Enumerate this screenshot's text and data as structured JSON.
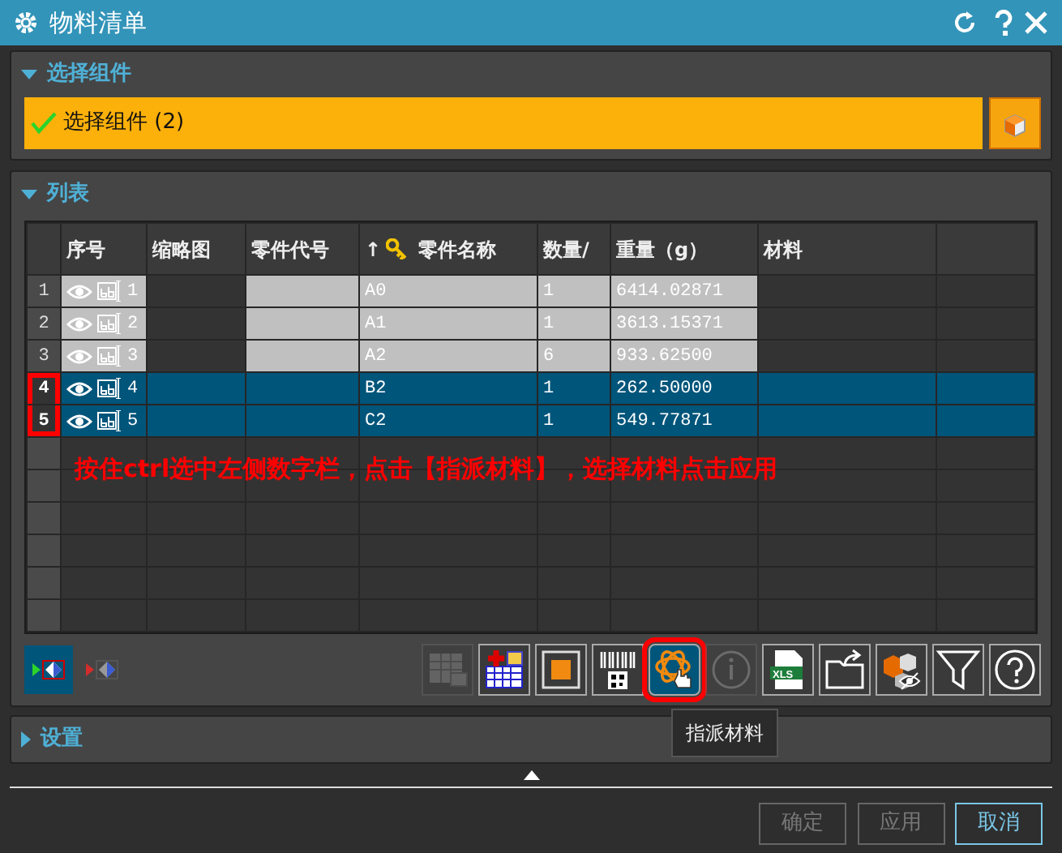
{
  "window": {
    "title": "物料清单"
  },
  "select_section": {
    "title": "选择组件",
    "expanded": true,
    "field": {
      "label": "选择组件 (2)",
      "valid": true
    }
  },
  "list_section": {
    "title": "列表",
    "expanded": true,
    "table": {
      "columns": [
        {
          "label": "序号",
          "sorted": false
        },
        {
          "label": "缩略图",
          "sorted": false
        },
        {
          "label": "零件代号",
          "sorted": false
        },
        {
          "label": "零件名称",
          "sorted": true,
          "sort_mark": "↑"
        },
        {
          "label": "数量/",
          "sorted": false
        },
        {
          "label": "重量（g）",
          "sorted": false
        },
        {
          "label": "材料",
          "sorted": false
        }
      ],
      "rows": [
        {
          "index": "1",
          "seq": "1",
          "part_code": "",
          "part_name": "A0",
          "quantity": "1",
          "weight": "6414.02871",
          "material": "",
          "selected": false,
          "circled": false
        },
        {
          "index": "2",
          "seq": "2",
          "part_code": "",
          "part_name": "A1",
          "quantity": "1",
          "weight": "3613.15371",
          "material": "",
          "selected": false,
          "circled": false
        },
        {
          "index": "3",
          "seq": "3",
          "part_code": "",
          "part_name": "A2",
          "quantity": "6",
          "weight": "933.62500",
          "material": "",
          "selected": false,
          "circled": false
        },
        {
          "index": "4",
          "seq": "4",
          "part_code": "",
          "part_name": "B2",
          "quantity": "1",
          "weight": "262.50000",
          "material": "",
          "selected": true,
          "circled": true
        },
        {
          "index": "5",
          "seq": "5",
          "part_code": "",
          "part_name": "C2",
          "quantity": "1",
          "weight": "549.77871",
          "material": "",
          "selected": true,
          "circled": true
        }
      ]
    },
    "annotation": "按住ctrl选中左侧数字栏，点击【指派材料】，选择材料点击应用",
    "view_toggles": [
      {
        "kind": "show",
        "selected": true
      },
      {
        "kind": "hide",
        "selected": false
      }
    ],
    "tools": [
      {
        "kind": "grid",
        "disabled": true,
        "highlighted": false
      },
      {
        "kind": "add-table",
        "disabled": false,
        "highlighted": false
      },
      {
        "kind": "square",
        "disabled": false,
        "highlighted": false
      },
      {
        "kind": "barcode",
        "disabled": false,
        "highlighted": false
      },
      {
        "kind": "assign",
        "disabled": false,
        "highlighted": true
      },
      {
        "kind": "info",
        "disabled": true,
        "highlighted": false
      },
      {
        "kind": "xls",
        "disabled": false,
        "highlighted": false,
        "label": "XLS"
      },
      {
        "kind": "export",
        "disabled": false,
        "highlighted": false
      },
      {
        "kind": "hide-parts",
        "disabled": false,
        "highlighted": false
      },
      {
        "kind": "filter",
        "disabled": false,
        "highlighted": false
      },
      {
        "kind": "help",
        "disabled": false,
        "highlighted": false
      }
    ],
    "tooltip": "指派材料"
  },
  "settings_section": {
    "title": "设置",
    "expanded": false
  },
  "buttons": [
    {
      "label": "确定",
      "disabled": true
    },
    {
      "label": "应用",
      "disabled": true
    },
    {
      "label": "取消",
      "disabled": false
    }
  ]
}
